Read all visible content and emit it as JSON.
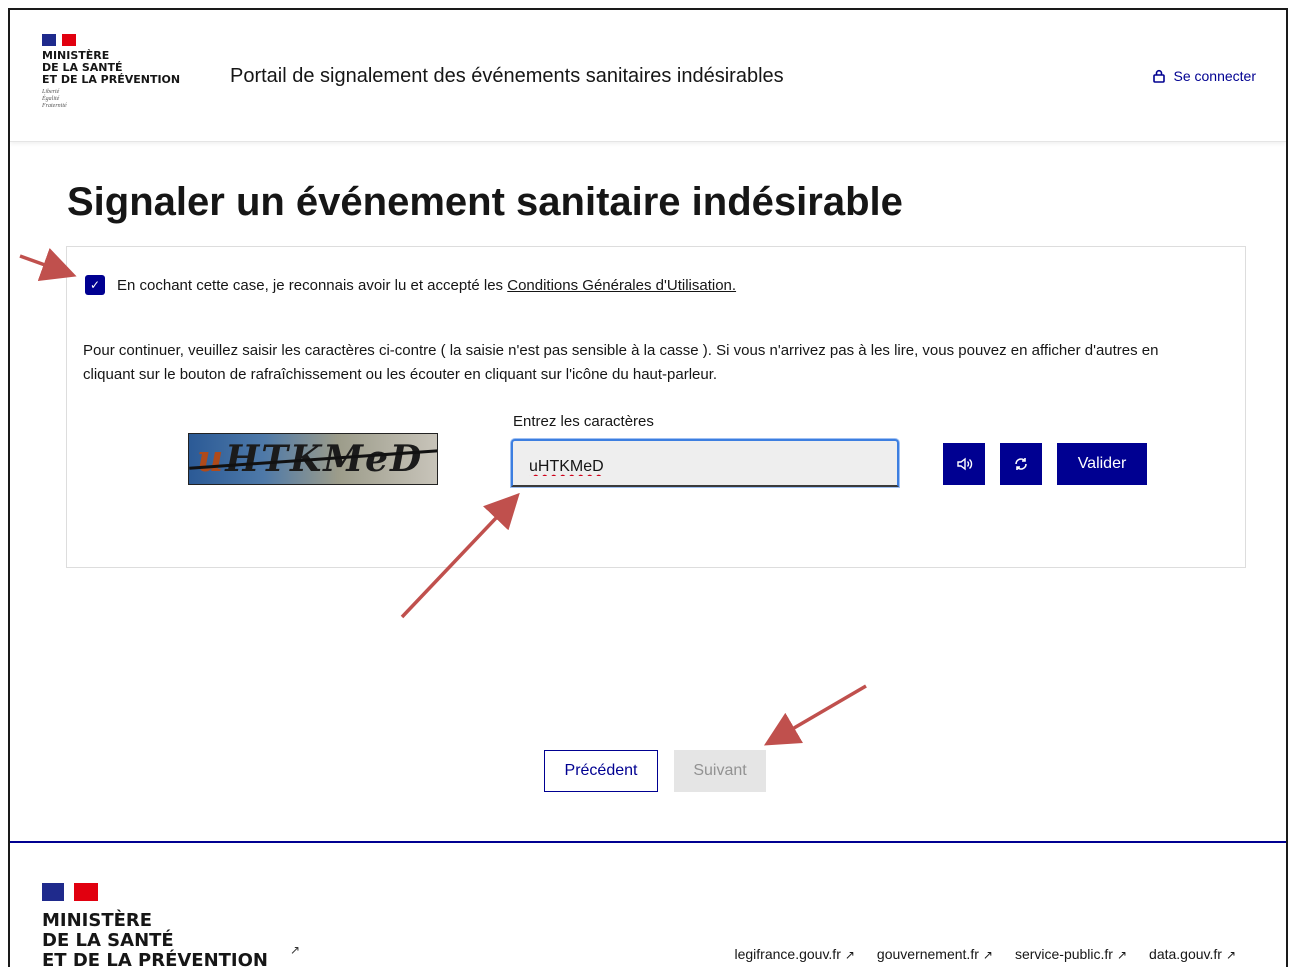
{
  "header": {
    "ministry_line1": "Ministère",
    "ministry_line2": "de la santé",
    "ministry_line3": "et de la prévention",
    "motto_line1": "Liberté",
    "motto_line2": "Égalité",
    "motto_line3": "Fraternité",
    "portal_title": "Portail de signalement des événements sanitaires indésirables",
    "login_label": "Se connecter"
  },
  "main": {
    "title": "Signaler un événement sanitaire indésirable",
    "cgu_checked": true,
    "cgu_text": "En cochant cette case, je reconnais avoir lu et accepté les",
    "cgu_link": "Conditions Générales d'Utilisation.",
    "instructions": "Pour continuer, veuillez saisir les caractères ci-contre ( la saisie n'est pas sensible à la casse ). Si vous n'arrivez pas à les lire, vous pouvez en afficher d'autres en cliquant sur le bouton de rafraîchissement ou les écouter en cliquant sur l'icône du haut-parleur.",
    "captcha_text_prefix": "u",
    "captcha_text_rest": "HTKMeD",
    "field_label": "Entrez les caractères",
    "field_value": "uHTKMeD",
    "validate_label": "Valider"
  },
  "navigation": {
    "previous_label": "Précédent",
    "next_label": "Suivant"
  },
  "footer": {
    "ministry_line1": "Ministère",
    "ministry_line2": "de la santé",
    "ministry_line3": "et de la prévention",
    "links": [
      "legifrance.gouv.fr",
      "gouvernement.fr",
      "service-public.fr",
      "data.gouv.fr"
    ]
  },
  "colors": {
    "primary": "#000091",
    "annotation_arrow": "#c0504d",
    "disabled_bg": "#e5e5e5"
  }
}
